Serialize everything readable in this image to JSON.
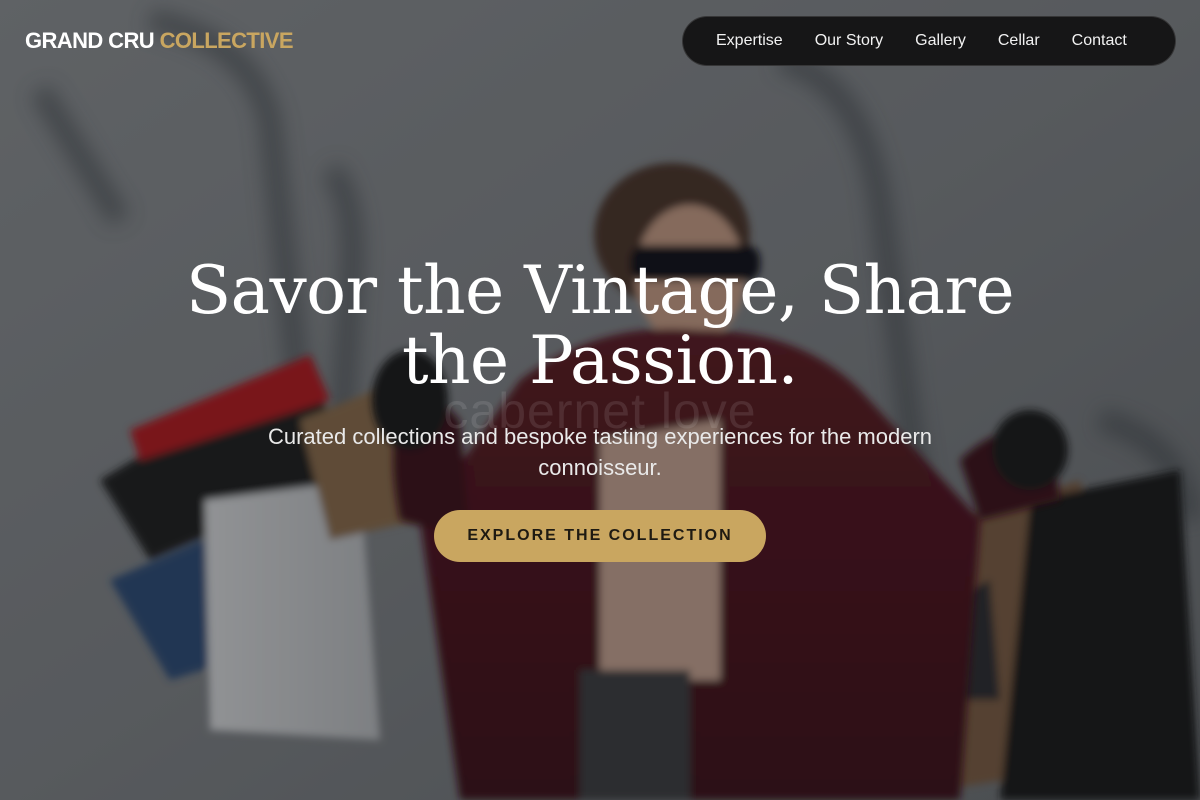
{
  "header": {
    "logo_primary": "GRAND CRU",
    "logo_accent": "COLLECTIVE"
  },
  "nav": {
    "items": [
      {
        "label": "Expertise"
      },
      {
        "label": "Our Story"
      },
      {
        "label": "Gallery"
      },
      {
        "label": "Cellar"
      },
      {
        "label": "Contact"
      }
    ]
  },
  "hero": {
    "headline_line1": "Savor the Vintage, Share",
    "headline_line2": "the Passion.",
    "watermark": "cabernet love",
    "subtitle": "Curated collections and bespoke tasting experiences for the modern connoisseur.",
    "cta_label": "EXPLORE THE COLLECTION"
  },
  "colors": {
    "accent": "#c9a660",
    "nav_bg": "#161617",
    "text": "#ffffff"
  }
}
